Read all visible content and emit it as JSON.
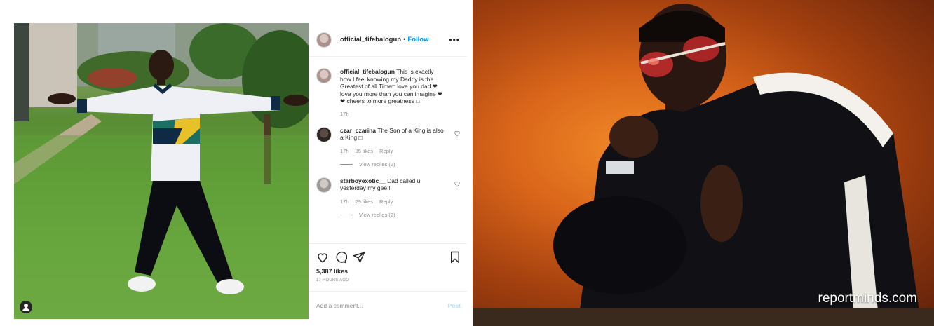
{
  "instagram": {
    "header": {
      "handle": "official_tifebalogun",
      "separator": "•",
      "follow_label": "Follow",
      "more_label": "•••"
    },
    "comments": [
      {
        "user": "official_tifebalogun",
        "text": "This is exactly how I feel knowing my Daddy is the Greatest of all Time□ love you dad ❤ love you more than you can imagine ❤❤ cheers to more greatness □",
        "time": "17h"
      },
      {
        "user": "czar_czarina",
        "text": "The Son of a King is also a King □",
        "time": "17h",
        "likes": "35 likes",
        "reply_label": "Reply",
        "view_replies": "View replies (2)"
      },
      {
        "user": "starboyexotic__",
        "text": "Dad called u yesterday my gee!!",
        "time": "17h",
        "likes": "29 likes",
        "reply_label": "Reply",
        "view_replies": "View replies (2)"
      }
    ],
    "likes_count": "5,387 likes",
    "posted_ago": "17 HOURS AGO",
    "comment_placeholder": "Add a comment...",
    "post_label": "Post",
    "icons": [
      "heart-icon",
      "comment-icon",
      "share-icon",
      "bookmark-icon",
      "user-tag-icon"
    ]
  },
  "watermark": "reportminds.com",
  "colors": {
    "link_blue": "#0095f6",
    "post_disabled": "#b2dffc",
    "meta_gray": "#8e8e8e",
    "text_dark": "#262626"
  }
}
